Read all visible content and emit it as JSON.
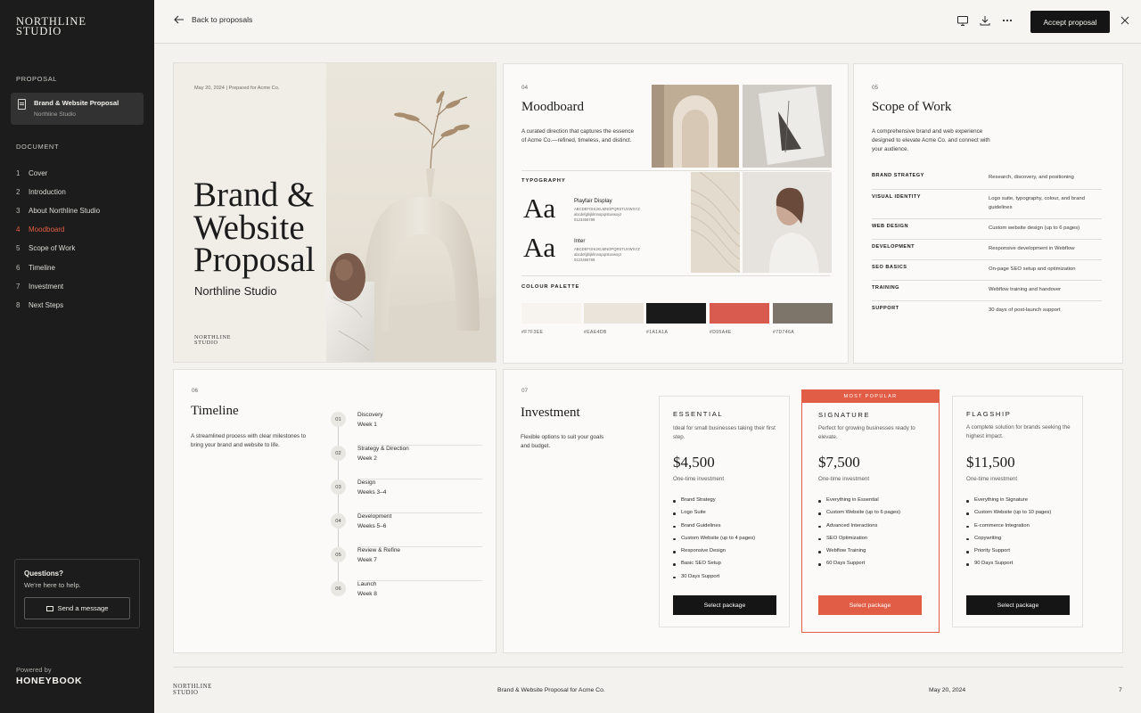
{
  "sidebar": {
    "logo_line1": "NORTHLINE",
    "logo_line2": "STUDIO",
    "proposal_label": "PROPOSAL",
    "doc_title": "Brand & Website Proposal",
    "doc_subtitle": "Northline Studio",
    "document_label": "DOCUMENT",
    "items": [
      {
        "num": "1",
        "label": "Cover"
      },
      {
        "num": "2",
        "label": "Introduction"
      },
      {
        "num": "3",
        "label": "About Northline Studio"
      },
      {
        "num": "4",
        "label": "Moodboard"
      },
      {
        "num": "5",
        "label": "Scope of Work"
      },
      {
        "num": "6",
        "label": "Timeline"
      },
      {
        "num": "7",
        "label": "Investment"
      },
      {
        "num": "8",
        "label": "Next Steps"
      }
    ],
    "active_index": 3,
    "questions_title": "Questions?",
    "questions_text": "We're here to help.",
    "send_message": "Send a message",
    "powered_by": "Powered by",
    "brand": "HONEYBOOK"
  },
  "topbar": {
    "back_label": "Back to proposals",
    "accept_label": "Accept proposal",
    "icons": [
      "monitor-icon",
      "download-icon",
      "more-icon",
      "close-icon"
    ]
  },
  "cover": {
    "meta": "May 20, 2024   |   Prepared for Acme Co.",
    "title_line1": "Brand &",
    "title_line2": "Website",
    "title_line3": "Proposal",
    "subtitle": "Northline Studio",
    "logo_line1": "NORTHLINE",
    "logo_line2": "STUDIO"
  },
  "moodboard": {
    "num": "04",
    "title": "Moodboard",
    "desc": "A curated direction that captures the essence of Acme Co.—refined, timeless, and distinct.",
    "typography_label": "TYPOGRAPHY",
    "fonts": [
      {
        "sample": "Aa",
        "name": "Playfair Display",
        "glyphs1": "ABCDEFGHIJKLMNOPQRSTUVWXYZ",
        "glyphs2": "abcdefghijklmnopqrstuvwxyz",
        "glyphs3": "0123456789"
      },
      {
        "sample": "Aa",
        "name": "Inter",
        "glyphs1": "ABCDEFGHIJKLMNOPQRSTUVWXYZ",
        "glyphs2": "abcdefghijklmnopqrstuvwxyz",
        "glyphs3": "0123456789"
      }
    ],
    "palette_label": "COLOUR PALETTE",
    "palette": [
      {
        "hex": "#F7F3EE",
        "color": "#F7F3EE"
      },
      {
        "hex": "#EAE4DB",
        "color": "#EAE4DB"
      },
      {
        "hex": "#1A1A1A",
        "color": "#1A1A1A"
      },
      {
        "hex": "#D95A4E",
        "color": "#D95A4E"
      },
      {
        "hex": "#7D746A",
        "color": "#7D746A"
      }
    ]
  },
  "scope": {
    "num": "05",
    "title": "Scope of Work",
    "desc": "A comprehensive brand and web experience designed to elevate Acme Co. and connect with your audience.",
    "rows": [
      {
        "key": "BRAND STRATEGY",
        "value": "Research, discovery, and positioning"
      },
      {
        "key": "VISUAL IDENTITY",
        "value": "Logo suite, typography, colour, and brand guidelines"
      },
      {
        "key": "WEB DESIGN",
        "value": "Custom website design (up to 6 pages)"
      },
      {
        "key": "DEVELOPMENT",
        "value": "Responsive development in Webflow"
      },
      {
        "key": "SEO BASICS",
        "value": "On-page SEO setup and optimization"
      },
      {
        "key": "TRAINING",
        "value": "Webflow training and handover"
      },
      {
        "key": "SUPPORT",
        "value": "30 days of post-launch support"
      }
    ]
  },
  "timeline": {
    "num": "06",
    "title": "Timeline",
    "desc": "A streamlined process with clear milestones to bring your brand and website to life.",
    "steps": [
      {
        "num": "01",
        "name": "Discovery",
        "week": "Week 1"
      },
      {
        "num": "02",
        "name": "Strategy & Direction",
        "week": "Week 2"
      },
      {
        "num": "03",
        "name": "Design",
        "week": "Weeks 3–4"
      },
      {
        "num": "04",
        "name": "Development",
        "week": "Weeks 5–6"
      },
      {
        "num": "05",
        "name": "Review & Refine",
        "week": "Week 7"
      },
      {
        "num": "06",
        "name": "Launch",
        "week": "Week 8"
      }
    ]
  },
  "investment": {
    "num": "07",
    "title": "Investment",
    "desc": "Flexible options to suit your goals and budget.",
    "packages": [
      {
        "name": "ESSENTIAL",
        "desc": "Ideal for small businesses taking their first step.",
        "price": "$4,500",
        "once": "One-time investment",
        "features": [
          "Brand Strategy",
          "Logo Suite",
          "Brand Guidelines",
          "Custom Website (up to 4 pages)",
          "Responsive Design",
          "Basic SEO Setup",
          "30 Days Support"
        ],
        "button": "Select package"
      },
      {
        "name": "SIGNATURE",
        "tag": "MOST POPULAR",
        "desc": "Perfect for growing businesses ready to elevate.",
        "price": "$7,500",
        "once": "One-time investment",
        "features": [
          "Everything in Essential",
          "Custom Website (up to 6 pages)",
          "Advanced Interactions",
          "SEO Optimization",
          "Webflow Training",
          "60 Days Support"
        ],
        "button": "Select package"
      },
      {
        "name": "FLAGSHIP",
        "desc": "A complete solution for brands seeking the highest impact.",
        "price": "$11,500",
        "once": "One-time investment",
        "features": [
          "Everything in Signature",
          "Custom Website (up to 10 pages)",
          "E-commerce Integration",
          "Copywriting",
          "Priority Support",
          "90 Days Support"
        ],
        "button": "Select package"
      }
    ]
  },
  "footer": {
    "logo_line1": "NORTHLINE",
    "logo_line2": "STUDIO",
    "title": "Brand & Website Proposal for Acme Co.",
    "date": "May 20, 2024",
    "page": "7"
  },
  "colors": {
    "accent": "#e25d45",
    "sidebar_bg": "#1c1c1c",
    "page_bg": "#f3f2ee"
  }
}
